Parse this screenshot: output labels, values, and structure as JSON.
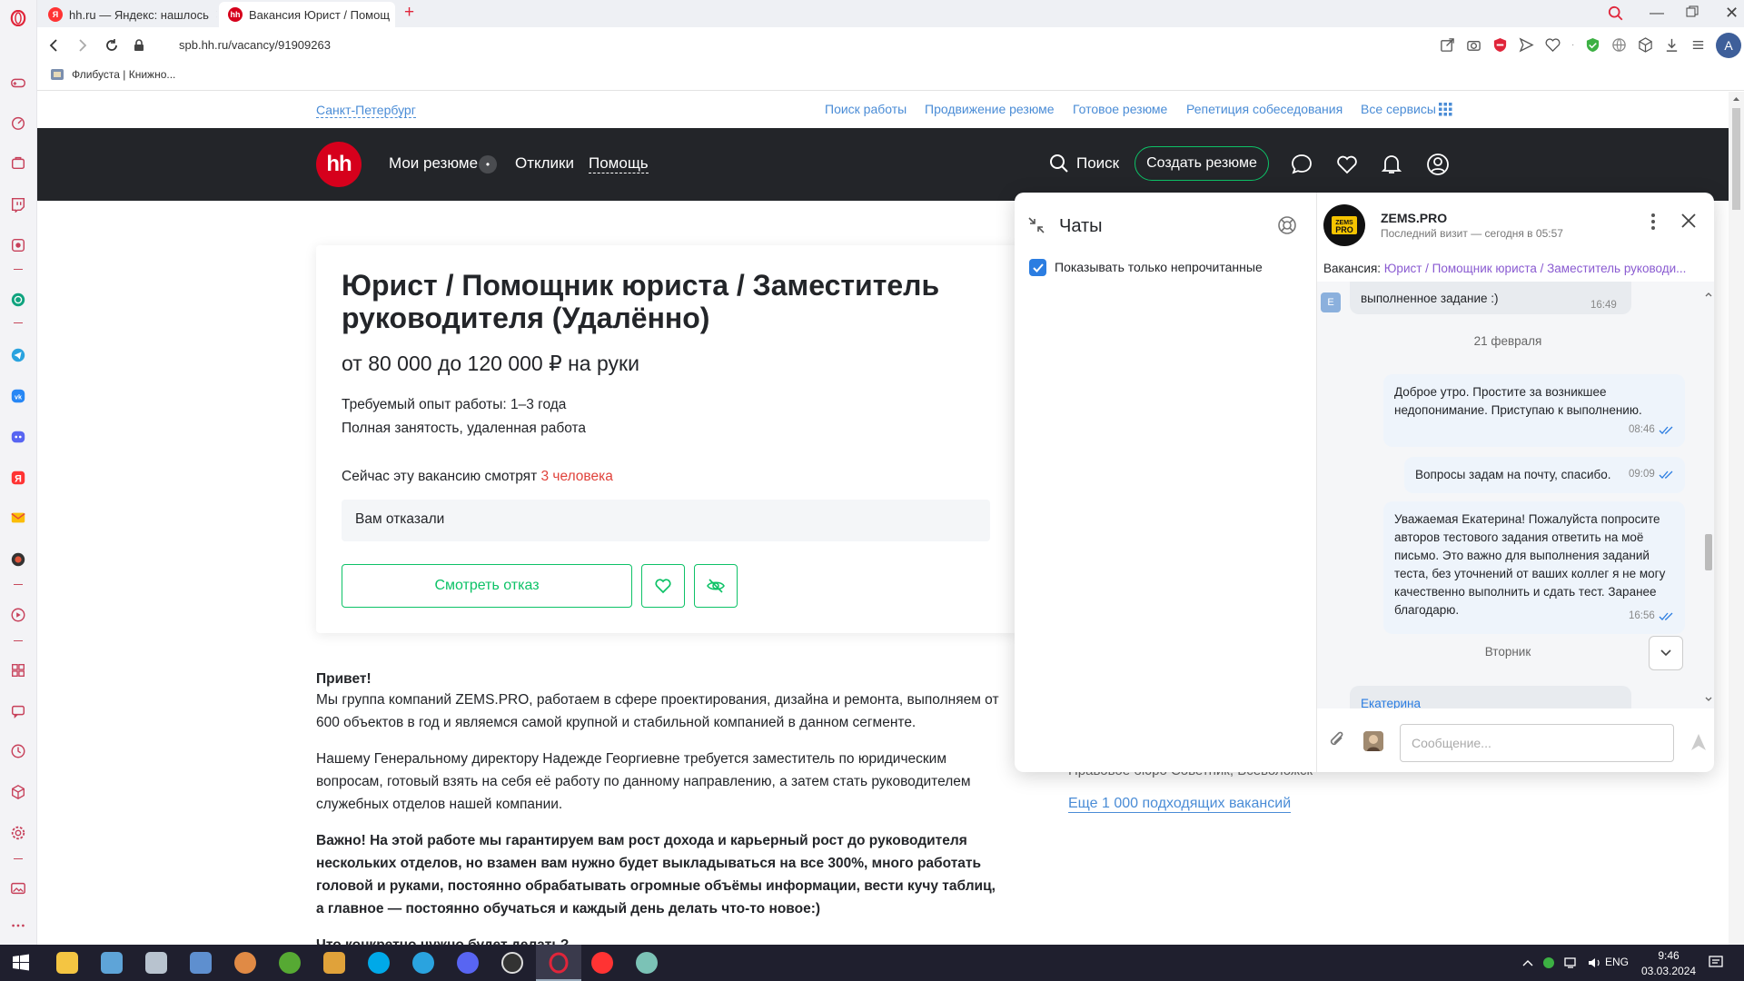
{
  "browser": {
    "tabs": [
      {
        "label": "hh.ru — Яндекс: нашлось",
        "favicon": "yandex-icon"
      },
      {
        "label": "Вакансия Юрист / Помощ",
        "favicon": "hh-icon"
      }
    ],
    "new_tab": "+",
    "url": "spb.hh.ru/vacancy/91909263",
    "bookmarks": [
      {
        "label": "Флибуста | Книжно..."
      }
    ],
    "profile_letter": "A"
  },
  "top_links": {
    "city": "Санкт-Петербург",
    "links": [
      "Поиск работы",
      "Продвижение резюме",
      "Готовое резюме",
      "Репетиция собеседования",
      "Все сервисы"
    ]
  },
  "header": {
    "logo": "hh",
    "nav": [
      "Мои резюме",
      "Отклики",
      "Помощь"
    ],
    "resume_badge": "•",
    "search_label": "Поиск",
    "create_resume": "Создать резюме"
  },
  "vacancy": {
    "title": "Юрист / Помощник юриста / Заместитель руководителя (Удалённо)",
    "salary": "от 80 000 до 120 000 ₽ на руки",
    "experience": "Требуемый опыт работы: 1–3 года",
    "employment": "Полная занятость, удаленная работа",
    "watching_prefix": "Сейчас эту вакансию смотрят",
    "watching_count": "3 человека",
    "rejected": "Вам отказали",
    "view_rejection": "Смотреть отказ"
  },
  "description": {
    "greeting": "Привет!",
    "p1": "Мы группа компаний ZEMS.PRO, работаем в сфере проектирования, дизайна и ремонта, выполняем от 600 объектов в год и являемся самой крупной и стабильной компанией в данном сегменте.",
    "p2": "Нашему Генеральному директору Надежде Георгиевне требуется заместитель по юридическим вопросам, готовый взять на себя её работу по данному направлению, а затем стать руководителем служебных отделов нашей компании.",
    "p3": "Важно! На этой работе мы гарантируем вам рост дохода и карьерный рост до руководителя нескольких отделов, но взамен вам нужно будет выкладываться на все 300%, много работать головой и руками, постоянно обрабатывать огромные объёмы информации, вести кучу таблиц, а главное — постоянно обучаться и каждый день делать что-то новое:)",
    "p4_partial": "Что конкретно нужно будет делать?"
  },
  "side": {
    "behind_text": "Правовое бюро Советник, Всеволожск",
    "more_link": "Еще 1 000 подходящих вакансий"
  },
  "chat": {
    "title": "Чаты",
    "only_unread": "Показывать только непрочитанные",
    "company": "ZEMS.PRO",
    "last_visit": "Последний визит — сегодня в 05:57",
    "vacancy_prefix": "Вакансия:",
    "vacancy_link": "Юрист / Помощник юриста / Заместитель руководи...",
    "avatar_letter": "Е",
    "msg0": {
      "text": "выполненное задание :)",
      "time": "16:49"
    },
    "date1": "21 февраля",
    "msg1": {
      "text": "Доброе утро. Простите за возникшее недопонимание. Приступаю к выполнению.",
      "time": "08:46"
    },
    "msg2": {
      "text": "Вопросы задам на почту, спасибо.",
      "time": "09:09"
    },
    "msg3": {
      "text": "Уважаемая Екатерина! Пожалуйста попросите авторов тестового задания ответить на моё письмо. Это важно для выполнения заданий теста, без уточнений от ваших коллег я не могу качественно выполнить и сдать тест. Заранее благодарю.",
      "time": "16:56"
    },
    "date2": "Вторник",
    "msg4_name": "Екатерина",
    "input_placeholder": "Сообщение..."
  },
  "taskbar": {
    "lang": "ENG",
    "time": "9:46",
    "date": "03.03.2024"
  },
  "colors": {
    "hh_red": "#d6001c",
    "hh_dark": "#232529",
    "green": "#0dc267",
    "link_blue": "#4a8cd6",
    "purple_link": "#8a5bd1",
    "bubble": "#eef4fb"
  }
}
